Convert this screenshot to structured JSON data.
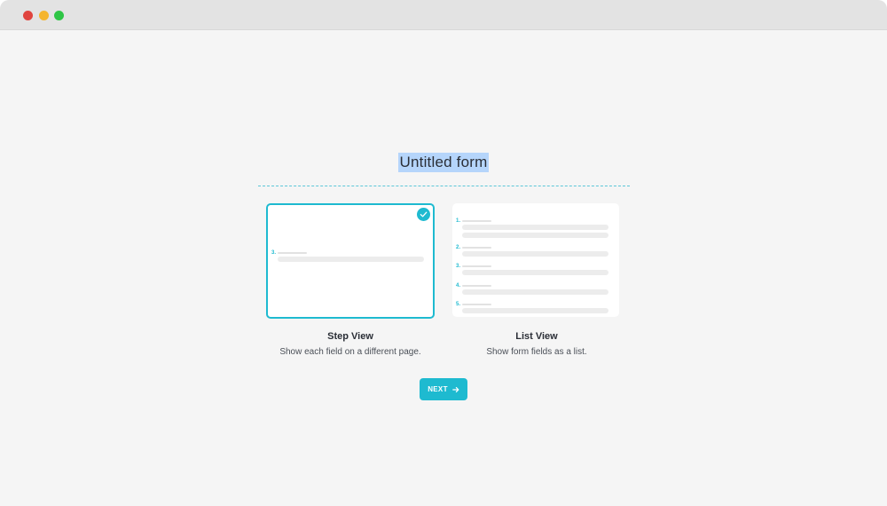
{
  "window": {
    "controls": [
      "close",
      "minimize",
      "maximize"
    ],
    "control_colors": {
      "close": "#e0443e",
      "minimize": "#f5b52e",
      "maximize": "#2ec545"
    }
  },
  "form": {
    "title": "Untitled form"
  },
  "options": [
    {
      "id": "step",
      "title": "Step View",
      "description": "Show each field on a different page.",
      "selected": true,
      "preview_numbers": [
        "3."
      ]
    },
    {
      "id": "list",
      "title": "List View",
      "description": "Show form fields as a list.",
      "selected": false,
      "preview_numbers": [
        "1.",
        "2.",
        "3.",
        "4.",
        "5."
      ]
    }
  ],
  "actions": {
    "next_label": "NEXT",
    "next_icon": "arrow-right-icon"
  },
  "icons": {
    "selected_check": "check-circle-icon"
  },
  "colors": {
    "accent": "#1ebad0",
    "selection_highlight": "#b5d5fb",
    "background": "#f5f5f5",
    "titlebar": "#e3e3e3"
  }
}
